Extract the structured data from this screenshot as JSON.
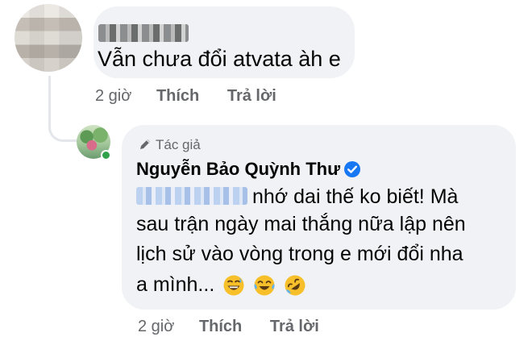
{
  "comment1": {
    "text": "Vẫn chưa đổi atvata àh e",
    "time": "2 giờ",
    "like_label": "Thích",
    "reply_label": "Trả lời"
  },
  "comment2": {
    "badge": "Tác giả",
    "author": "Nguyễn Bảo Quỳnh Thư",
    "line1_rest": "nhớ dai thế ko biết! Mà",
    "line2": "sau trận ngày mai thắng nữa lập nên",
    "line3": "lịch sử vào vòng trong e mới đổi nha",
    "line4": "a mình...",
    "time": "2 giờ",
    "like_label": "Thích",
    "reply_label": "Trả lời",
    "emojis": [
      "grinning-sweat-emoji",
      "joy-emoji",
      "rofl-emoji"
    ]
  },
  "colors": {
    "bubble": "#f0f2f5",
    "meta": "#65676b",
    "verified": "#1877f2",
    "online": "#31a24c",
    "emoji": "#f7c02b"
  }
}
